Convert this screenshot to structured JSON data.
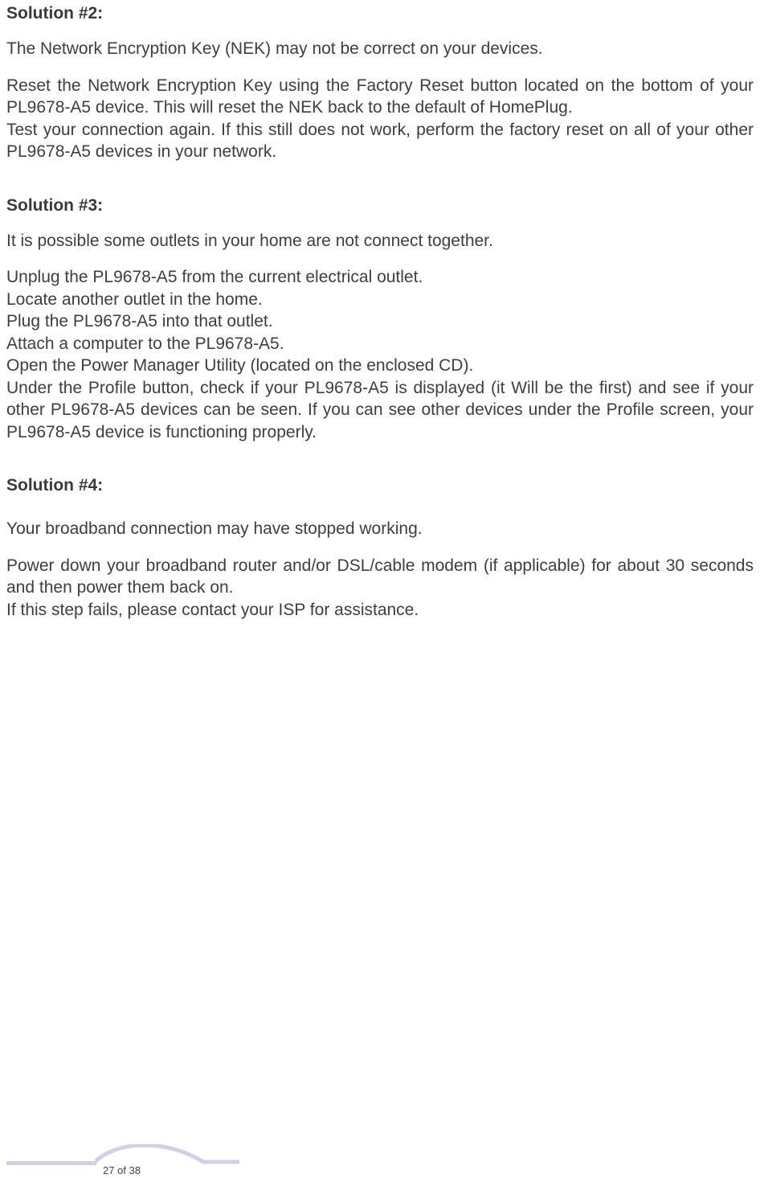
{
  "solution2": {
    "heading": "Solution #2:",
    "p1": "The Network Encryption Key (NEK) may not be correct on your devices.",
    "p2": "Reset the Network Encryption Key using the Factory Reset button located on the bottom of your PL9678-A5 device. This will reset the NEK back to the default of HomePlug.",
    "p3": "Test your connection again. If this still does not work, perform the factory reset on all of your other PL9678-A5 devices in your network."
  },
  "solution3": {
    "heading": "Solution #3:",
    "p1": "It is possible some outlets in your home are not connect together.",
    "l1": "Unplug the PL9678-A5 from the current electrical outlet.",
    "l2": "Locate another outlet in the home.",
    "l3": "Plug the PL9678-A5 into that outlet.",
    "l4": "Attach a computer to the PL9678-A5.",
    "l5": "Open the Power Manager Utility (located on the enclosed CD).",
    "l6": "Under the Profile button, check if your PL9678-A5 is displayed (it Will be the first) and see if your other PL9678-A5 devices can be seen. If you can see other devices under the Profile screen, your PL9678-A5 device is functioning properly."
  },
  "solution4": {
    "heading": "Solution #4:",
    "p1": "Your broadband connection may have stopped working.",
    "p2": "Power down your broadband router and/or DSL/cable modem (if applicable) for about 30 seconds and then power them back on.",
    "p3": "If this step fails, please contact your ISP for assistance."
  },
  "footer": {
    "page_number": "27 of 38"
  }
}
